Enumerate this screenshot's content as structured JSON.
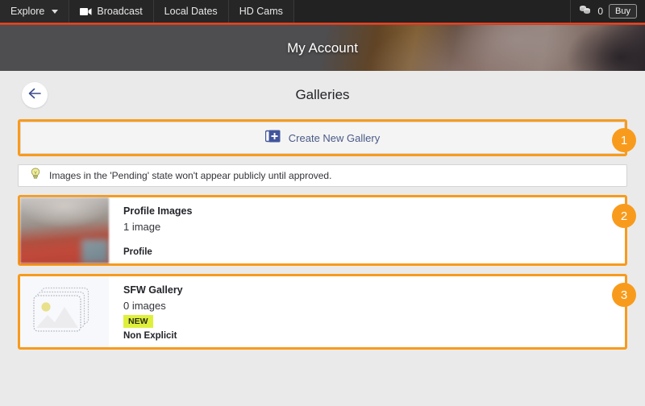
{
  "topnav": {
    "items": [
      {
        "label": "Explore",
        "icon": "chevron-down-icon"
      },
      {
        "label": "Broadcast",
        "icon": "video-camera-icon"
      },
      {
        "label": "Local Dates",
        "icon": ""
      },
      {
        "label": "HD Cams",
        "icon": ""
      }
    ],
    "coins": {
      "icon": "coins-icon",
      "count": "0"
    },
    "buy_label": "Buy"
  },
  "banner": {
    "title": "My Account"
  },
  "page": {
    "back_icon": "arrow-left-icon",
    "title": "Galleries"
  },
  "create": {
    "icon": "add-images-icon",
    "label": "Create New Gallery"
  },
  "notice": {
    "icon": "lightbulb-icon",
    "text": "Images in the 'Pending' state won't appear publicly until approved."
  },
  "galleries": [
    {
      "name": "Profile Images",
      "count": "1 image",
      "type": "Profile",
      "badge": "",
      "thumb": "photo-thumbnail"
    },
    {
      "name": "SFW Gallery",
      "count": "0 images",
      "type": "Non Explicit",
      "badge": "NEW",
      "thumb": "placeholder-image-icon"
    }
  ],
  "annotations": {
    "markers": [
      "1",
      "2",
      "3"
    ],
    "color": "#f89b1c"
  },
  "colors": {
    "accent_orange": "#f89b1c",
    "nav_bg": "#222222",
    "page_bg": "#eaeaea",
    "link_blue": "#4a5a86",
    "new_badge": "#dff03c",
    "top_rule_red": "#d23a1e"
  }
}
